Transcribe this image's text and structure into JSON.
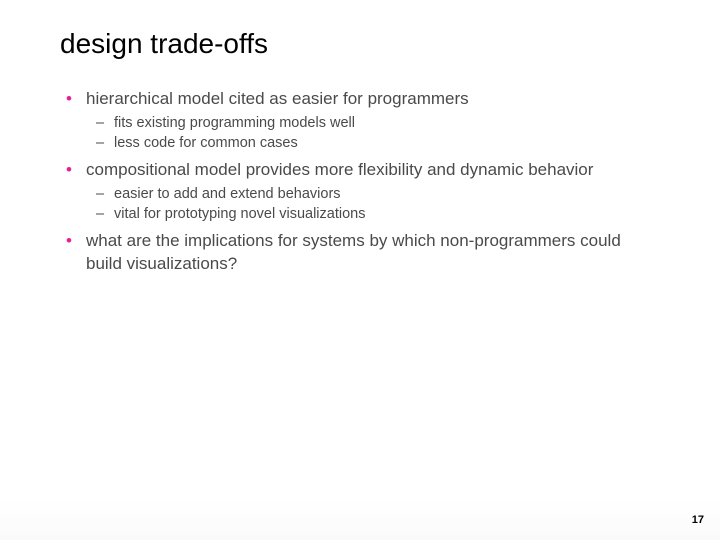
{
  "title": "design trade-offs",
  "bullets": [
    {
      "text": "hierarchical model cited as easier for programmers",
      "sub": [
        "fits existing programming models well",
        "less code for common cases"
      ]
    },
    {
      "text": "compositional model provides more flexibility and dynamic behavior",
      "sub": [
        "easier to add and extend behaviors",
        "vital for prototyping novel visualizations"
      ]
    },
    {
      "text": "what are the implications for systems by which non-programmers could build visualizations?",
      "sub": []
    }
  ],
  "page_number": "17"
}
